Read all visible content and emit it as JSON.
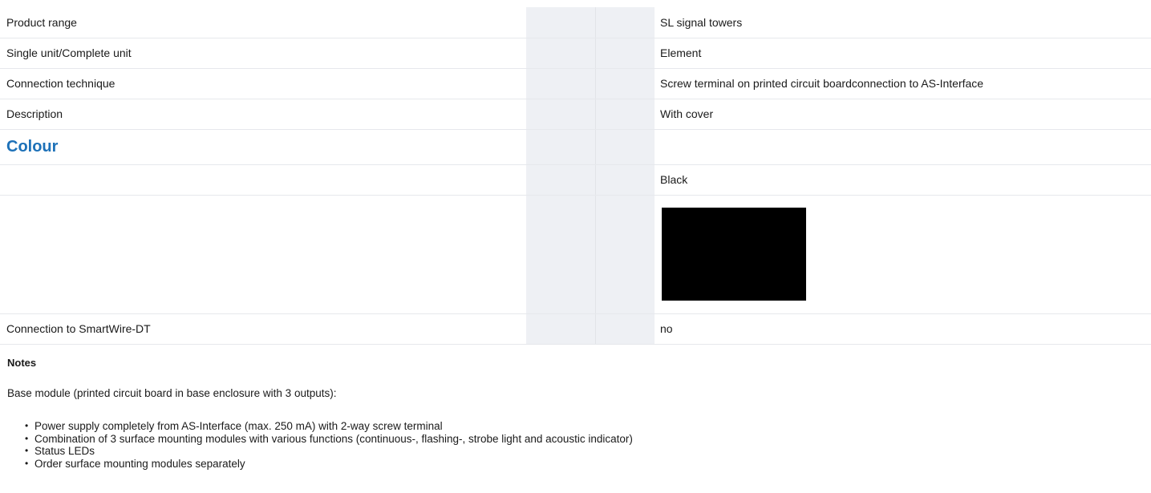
{
  "top_heading": "",
  "rows": [
    {
      "label": "Product range",
      "value": "SL signal towers"
    },
    {
      "label": "Single unit/Complete unit",
      "value": "Element"
    },
    {
      "label": "Connection technique",
      "value": "Screw terminal on printed circuit boardconnection to AS-Interface"
    },
    {
      "label": "Description",
      "value": "With cover"
    }
  ],
  "colour_section": {
    "heading": "Colour",
    "value": "Black",
    "swatch_color": "#000000"
  },
  "smartwire_row": {
    "label": "Connection to SmartWire-DT",
    "value": "no"
  },
  "notes": {
    "title": "Notes",
    "intro": "Base module (printed circuit board in base enclosure with 3 outputs):",
    "items": [
      "Power supply completely from AS-Interface (max. 250 mA) with 2-way screw terminal",
      "Combination of 3 surface mounting modules with various functions (continuous-, flashing-, strobe light and acoustic indicator)",
      "Status LEDs",
      "Order surface mounting modules separately"
    ]
  },
  "colors": {
    "accent_heading": "#1d71b8",
    "shaded_column": "#eef0f4",
    "row_divider": "#e6e8ec"
  }
}
